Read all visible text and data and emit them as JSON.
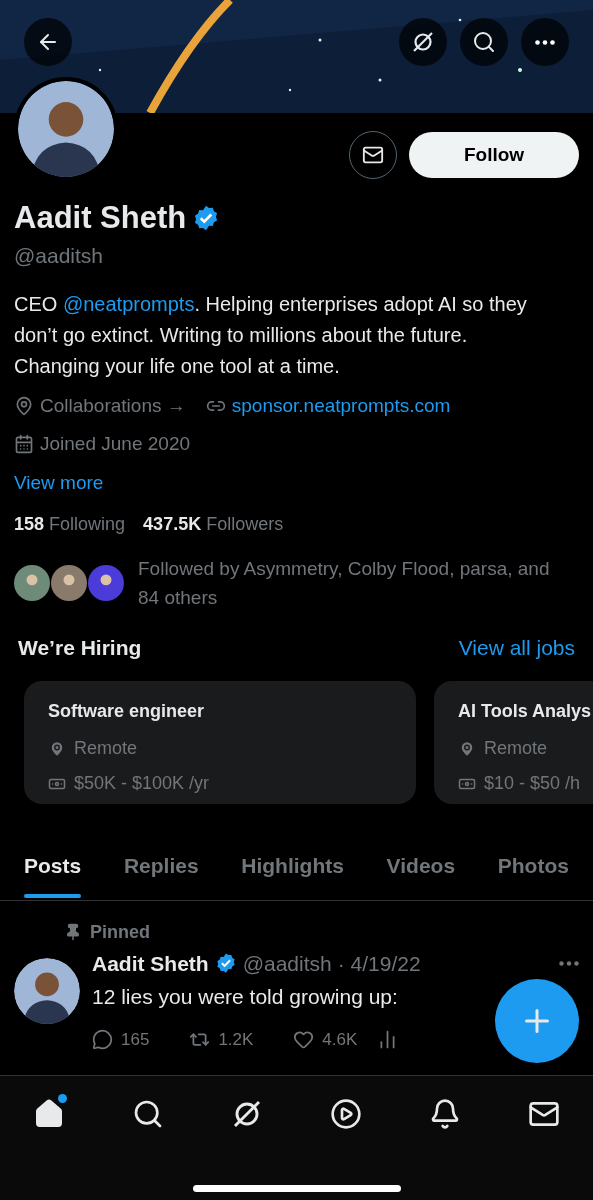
{
  "profile": {
    "name": "Aadit Sheth",
    "verified": true,
    "handle": "@aaditsh",
    "follow_button": "Follow",
    "bio": {
      "before": "CEO ",
      "mention": "@neatprompts",
      "after": ". Helping enterprises adopt AI so they don’t go extinct. Writing to millions about the future. Changing your life one tool at a time."
    },
    "location": "Collaborations →",
    "website": "sponsor.neatprompts.com",
    "joined": "Joined June 2020",
    "view_more": "View more",
    "following_count": "158",
    "following_label": "Following",
    "followers_count": "437.5K",
    "followers_label": "Followers",
    "followed_by": "Followed by Asymmetry, Colby Flood, parsa, and 84 others"
  },
  "hiring": {
    "title": "We’re Hiring",
    "view_all": "View all jobs",
    "jobs": [
      {
        "title": "Software engineer",
        "location": "Remote",
        "salary": "$50K - $100K /yr"
      },
      {
        "title": "AI Tools Analys",
        "location": "Remote",
        "salary": "$10 - $50 /h"
      }
    ]
  },
  "tabs": [
    {
      "label": "Posts",
      "selected": true
    },
    {
      "label": "Replies",
      "selected": false
    },
    {
      "label": "Highlights",
      "selected": false
    },
    {
      "label": "Videos",
      "selected": false
    },
    {
      "label": "Photos",
      "selected": false
    }
  ],
  "post": {
    "pinned_label": "Pinned",
    "author": "Aadit Sheth",
    "verified": true,
    "handle": "@aaditsh",
    "date": "· 4/19/22",
    "text": "12 lies you were told growing up:",
    "replies": "165",
    "reposts": "1.2K",
    "likes": "4.6K"
  },
  "nav": [
    {
      "kind": "home",
      "selected": true,
      "badge": true
    },
    {
      "kind": "search",
      "selected": false,
      "badge": false
    },
    {
      "kind": "grok",
      "selected": false,
      "badge": false
    },
    {
      "kind": "video",
      "selected": false,
      "badge": false
    },
    {
      "kind": "bell",
      "selected": false,
      "badge": false
    },
    {
      "kind": "mail",
      "selected": false,
      "badge": false
    }
  ]
}
